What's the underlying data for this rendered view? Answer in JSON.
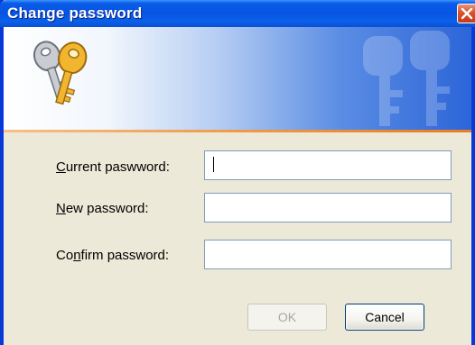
{
  "window": {
    "title": "Change password"
  },
  "form": {
    "current_password": {
      "accel": "C",
      "rest": "urrent paswword:",
      "value": ""
    },
    "new_password": {
      "accel": "N",
      "rest": "ew password:",
      "value": ""
    },
    "confirm_password": {
      "pre": "Co",
      "accel": "n",
      "rest": "firm password:",
      "value": ""
    }
  },
  "buttons": {
    "ok_label": "OK",
    "ok_state": "disabled",
    "cancel_label": "Cancel"
  },
  "icons": {
    "banner": "keys-icon",
    "close": "close-icon"
  },
  "colors": {
    "titlebar": "#0754e3",
    "close_button": "#d9532c",
    "banner_stripe": "#f09a47",
    "dialog_bg": "#ece9d8"
  }
}
